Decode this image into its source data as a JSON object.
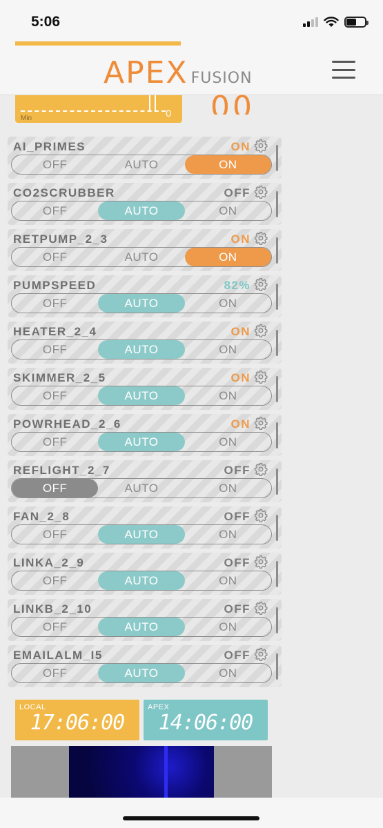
{
  "status_bar": {
    "time": "5:06",
    "icons": [
      "cellular-signal-icon",
      "wifi-icon",
      "battery-icon"
    ]
  },
  "header": {
    "logo_main": "APEX",
    "logo_sub": "FUSION",
    "menu_icon": "hamburger-menu-icon"
  },
  "gauge": {
    "min_label": "Min",
    "zero_label": "0",
    "big_value": "00"
  },
  "colors": {
    "accent_orange": "#ee9a4a",
    "accent_teal": "#8ccac9",
    "off_gray": "#8b8b8b",
    "tile_yellow": "#f2b949"
  },
  "switch_labels": {
    "off": "OFF",
    "auto": "AUTO",
    "on": "ON"
  },
  "outlets": [
    {
      "name": "AI_PRIMES",
      "state": "ON",
      "state_color": "#ee9a4a",
      "selected": "on"
    },
    {
      "name": "CO2SCRUBBER",
      "state": "OFF",
      "state_color": "#7a7a7a",
      "selected": "auto"
    },
    {
      "name": "RETPUMP_2_3",
      "state": "ON",
      "state_color": "#ee9a4a",
      "selected": "on"
    },
    {
      "name": "PUMPSPEED",
      "state": "82%",
      "state_color": "#7fc6c6",
      "selected": "auto"
    },
    {
      "name": "HEATER_2_4",
      "state": "ON",
      "state_color": "#ee9a4a",
      "selected": "auto"
    },
    {
      "name": "SKIMMER_2_5",
      "state": "ON",
      "state_color": "#ee9a4a",
      "selected": "auto"
    },
    {
      "name": "POWRHEAD_2_6",
      "state": "ON",
      "state_color": "#ee9a4a",
      "selected": "auto"
    },
    {
      "name": "REFLIGHT_2_7",
      "state": "OFF",
      "state_color": "#7a7a7a",
      "selected": "off"
    },
    {
      "name": "FAN_2_8",
      "state": "OFF",
      "state_color": "#7a7a7a",
      "selected": "auto"
    },
    {
      "name": "LINKA_2_9",
      "state": "OFF",
      "state_color": "#7a7a7a",
      "selected": "auto"
    },
    {
      "name": "LINKB_2_10",
      "state": "OFF",
      "state_color": "#7a7a7a",
      "selected": "auto"
    },
    {
      "name": "EMAILALM_I5",
      "state": "OFF",
      "state_color": "#7a7a7a",
      "selected": "auto"
    }
  ],
  "clocks": {
    "local_label": "LOCAL",
    "local_time": "17:06:00",
    "apex_label": "APEX",
    "apex_time": "14:06:00"
  }
}
